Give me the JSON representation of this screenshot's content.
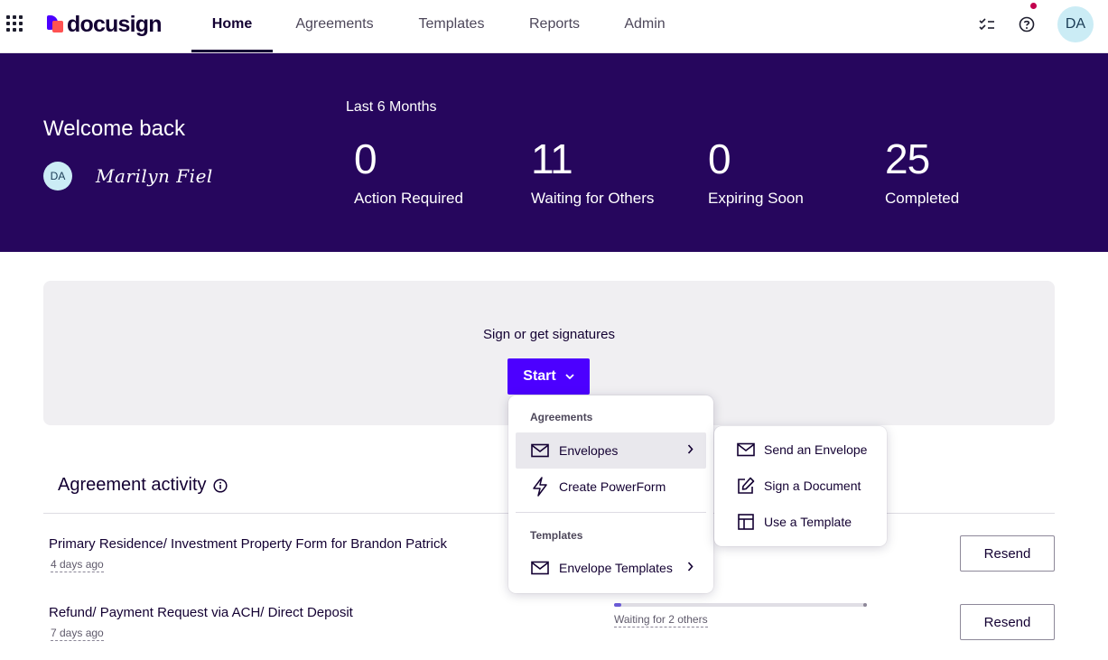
{
  "nav": {
    "brand": "docusign",
    "tabs": [
      {
        "label": "Home",
        "active": true
      },
      {
        "label": "Agreements",
        "active": false
      },
      {
        "label": "Templates",
        "active": false
      },
      {
        "label": "Reports",
        "active": false
      },
      {
        "label": "Admin",
        "active": false
      }
    ],
    "avatar_initials": "DA",
    "notification_color": "#c2004e"
  },
  "hero": {
    "welcome": "Welcome back",
    "avatar_initials": "DA",
    "signature": "Marilyn Fiel",
    "period": "Last 6 Months",
    "stats": [
      {
        "value": "0",
        "label": "Action Required"
      },
      {
        "value": "11",
        "label": "Waiting for Others"
      },
      {
        "value": "0",
        "label": "Expiring Soon"
      },
      {
        "value": "25",
        "label": "Completed"
      }
    ],
    "background_color": "#26065d"
  },
  "start_card": {
    "title": "Sign or get signatures",
    "button_label": "Start",
    "button_color": "#4c00ff"
  },
  "start_menu": {
    "sections": [
      {
        "heading": "Agreements",
        "items": [
          {
            "label": "Envelopes",
            "icon": "envelope-icon",
            "has_submenu": true,
            "highlighted": true
          },
          {
            "label": "Create PowerForm",
            "icon": "lightning-icon",
            "has_submenu": false,
            "highlighted": false
          }
        ]
      },
      {
        "heading": "Templates",
        "items": [
          {
            "label": "Envelope Templates",
            "icon": "envelope-icon",
            "has_submenu": true,
            "highlighted": false
          }
        ]
      }
    ],
    "submenu": [
      {
        "label": "Send an Envelope",
        "icon": "envelope-icon"
      },
      {
        "label": "Sign a Document",
        "icon": "pen-document-icon"
      },
      {
        "label": "Use a Template",
        "icon": "template-layout-icon"
      }
    ]
  },
  "activity": {
    "title": "Agreement activity",
    "rows": [
      {
        "title": "Primary Residence/ Investment Property Form for Brandon Patrick",
        "time": "4 days ago",
        "action": "Resend"
      },
      {
        "title": "Refund/ Payment Request via ACH/ Direct Deposit",
        "time": "7 days ago",
        "status": "Waiting for 2 others",
        "progress": 0.03,
        "action": "Resend"
      }
    ]
  }
}
